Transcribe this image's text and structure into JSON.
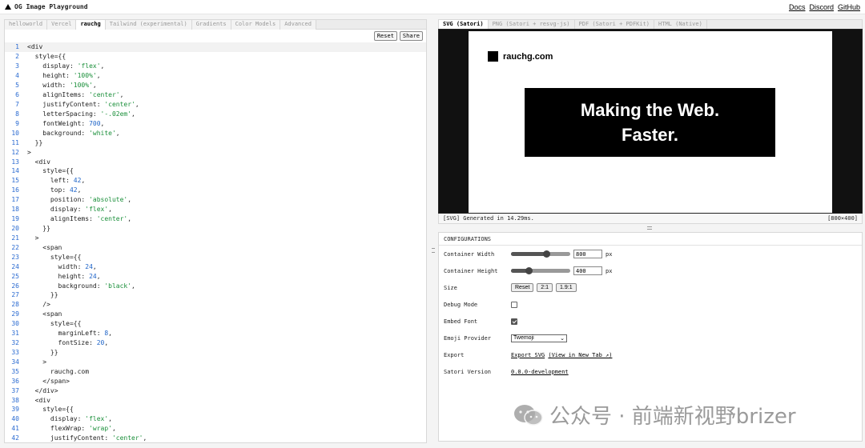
{
  "app": {
    "title": "OG Image Playground"
  },
  "nav": {
    "links": [
      "Docs",
      "Discord",
      "GitHub"
    ]
  },
  "editor": {
    "tabs": [
      "helloworld",
      "Vercel",
      "rauchg",
      "Tailwind (experimental)",
      "Gradients",
      "Color Models",
      "Advanced"
    ],
    "active_tab": "rauchg",
    "reset_label": "Reset",
    "share_label": "Share",
    "lines": [
      {
        "n": "1",
        "t": "<div"
      },
      {
        "n": "2",
        "t": "  style={{"
      },
      {
        "n": "3",
        "t": "    display: 'flex',"
      },
      {
        "n": "4",
        "t": "    height: '100%',"
      },
      {
        "n": "5",
        "t": "    width: '100%',"
      },
      {
        "n": "6",
        "t": "    alignItems: 'center',"
      },
      {
        "n": "7",
        "t": "    justifyContent: 'center',"
      },
      {
        "n": "8",
        "t": "    letterSpacing: '-.02em',"
      },
      {
        "n": "9",
        "t": "    fontWeight: 700,"
      },
      {
        "n": "10",
        "t": "    background: 'white',"
      },
      {
        "n": "11",
        "t": "  }}"
      },
      {
        "n": "12",
        "t": ">"
      },
      {
        "n": "13",
        "t": "  <div"
      },
      {
        "n": "14",
        "t": "    style={{"
      },
      {
        "n": "15",
        "t": "      left: 42,"
      },
      {
        "n": "16",
        "t": "      top: 42,"
      },
      {
        "n": "17",
        "t": "      position: 'absolute',"
      },
      {
        "n": "18",
        "t": "      display: 'flex',"
      },
      {
        "n": "19",
        "t": "      alignItems: 'center',"
      },
      {
        "n": "20",
        "t": "    }}"
      },
      {
        "n": "21",
        "t": "  >"
      },
      {
        "n": "22",
        "t": "    <span"
      },
      {
        "n": "23",
        "t": "      style={{"
      },
      {
        "n": "24",
        "t": "        width: 24,"
      },
      {
        "n": "25",
        "t": "        height: 24,"
      },
      {
        "n": "26",
        "t": "        background: 'black',"
      },
      {
        "n": "27",
        "t": "      }}"
      },
      {
        "n": "28",
        "t": "    />"
      },
      {
        "n": "29",
        "t": "    <span"
      },
      {
        "n": "30",
        "t": "      style={{"
      },
      {
        "n": "31",
        "t": "        marginLeft: 8,"
      },
      {
        "n": "32",
        "t": "        fontSize: 20,"
      },
      {
        "n": "33",
        "t": "      }}"
      },
      {
        "n": "34",
        "t": "    >"
      },
      {
        "n": "35",
        "t": "      rauchg.com"
      },
      {
        "n": "36",
        "t": "    </span>"
      },
      {
        "n": "37",
        "t": "  </div>"
      },
      {
        "n": "38",
        "t": "  <div"
      },
      {
        "n": "39",
        "t": "    style={{"
      },
      {
        "n": "40",
        "t": "      display: 'flex',"
      },
      {
        "n": "41",
        "t": "      flexWrap: 'wrap',"
      },
      {
        "n": "42",
        "t": "      justifyContent: 'center',"
      }
    ]
  },
  "preview": {
    "tabs": [
      "SVG (Satori)",
      "PNG (Satori + resvg-js)",
      "PDF (Satori + PDFKit)",
      "HTML (Native)"
    ],
    "active_tab": "SVG (Satori)",
    "logo_text": "rauchg.com",
    "hero_line1": "Making the Web.",
    "hero_line2": "Faster.",
    "status_left": "[SVG] Generated in 14.29ms.",
    "status_right": "[800×400]"
  },
  "config": {
    "heading": "CONFIGURATIONS",
    "container_width": {
      "label": "Container Width",
      "value": "800",
      "unit": "px",
      "level": 0.6
    },
    "container_height": {
      "label": "Container Height",
      "value": "400",
      "unit": "px",
      "level": 0.3
    },
    "size": {
      "label": "Size",
      "buttons": [
        "Reset",
        "2:1",
        "1.9:1"
      ]
    },
    "debug_mode": {
      "label": "Debug Mode",
      "checked": false
    },
    "embed_font": {
      "label": "Embed Font",
      "checked": true
    },
    "emoji_provider": {
      "label": "Emoji Provider",
      "value": "Twemoji"
    },
    "export": {
      "label": "Export",
      "export_svg": "Export SVG",
      "view_new_tab": "(View in New Tab ↗)"
    },
    "satori_version": {
      "label": "Satori Version",
      "value": "0.0.0-development"
    }
  },
  "watermark": {
    "text": "公众号 · 前端新视野brizer"
  }
}
